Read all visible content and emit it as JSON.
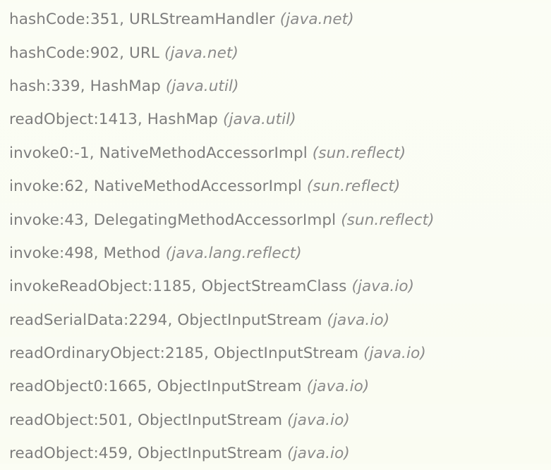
{
  "frames": [
    {
      "method": "hashCode:351, URLStreamHandler",
      "package": "(java.net)"
    },
    {
      "method": "hashCode:902, URL",
      "package": "(java.net)"
    },
    {
      "method": "hash:339, HashMap",
      "package": "(java.util)"
    },
    {
      "method": "readObject:1413, HashMap",
      "package": "(java.util)"
    },
    {
      "method": "invoke0:-1, NativeMethodAccessorImpl",
      "package": "(sun.reflect)"
    },
    {
      "method": "invoke:62, NativeMethodAccessorImpl",
      "package": "(sun.reflect)"
    },
    {
      "method": "invoke:43, DelegatingMethodAccessorImpl",
      "package": "(sun.reflect)"
    },
    {
      "method": "invoke:498, Method",
      "package": "(java.lang.reflect)"
    },
    {
      "method": "invokeReadObject:1185, ObjectStreamClass",
      "package": "(java.io)"
    },
    {
      "method": "readSerialData:2294, ObjectInputStream",
      "package": "(java.io)"
    },
    {
      "method": "readOrdinaryObject:2185, ObjectInputStream",
      "package": "(java.io)"
    },
    {
      "method": "readObject0:1665, ObjectInputStream",
      "package": "(java.io)"
    },
    {
      "method": "readObject:501, ObjectInputStream",
      "package": "(java.io)"
    },
    {
      "method": "readObject:459, ObjectInputStream",
      "package": "(java.io)"
    }
  ]
}
